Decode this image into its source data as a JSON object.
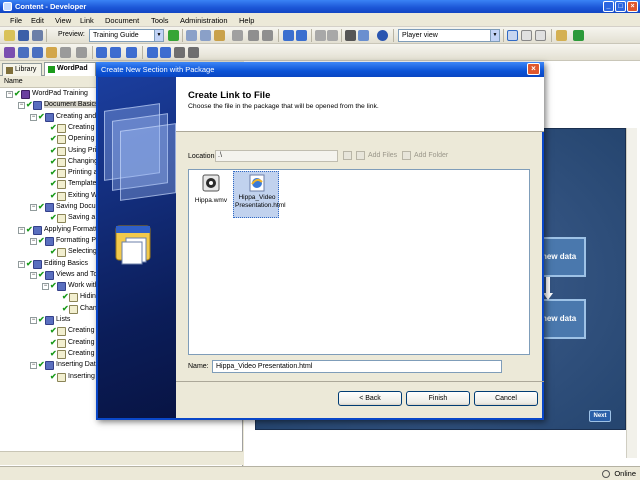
{
  "window": {
    "title": "Content - Developer"
  },
  "menu": [
    "File",
    "Edit",
    "View",
    "Link",
    "Document",
    "Tools",
    "Administration",
    "Help"
  ],
  "toolbar": {
    "preview_label": "Preview:",
    "preview_value": "Training Guide",
    "view_value": "Player view"
  },
  "left_panel": {
    "tabs": [
      "Library",
      "WordPad"
    ],
    "column_header": "Name",
    "tree": [
      {
        "label": "WordPad Training",
        "level": 0,
        "kind": "root"
      },
      {
        "label": "Document Basics",
        "level": 1,
        "kind": "book",
        "selected": true
      },
      {
        "label": "Creating and",
        "level": 2,
        "kind": "book"
      },
      {
        "label": "Creating a",
        "level": 3,
        "kind": "page"
      },
      {
        "label": "Opening a",
        "level": 3,
        "kind": "page"
      },
      {
        "label": "Using Prin",
        "level": 3,
        "kind": "page"
      },
      {
        "label": "Changing",
        "level": 3,
        "kind": "page"
      },
      {
        "label": "Printing a",
        "level": 3,
        "kind": "page"
      },
      {
        "label": "Templates",
        "level": 3,
        "kind": "page"
      },
      {
        "label": "Exiting W",
        "level": 3,
        "kind": "page"
      },
      {
        "label": "Saving Docum",
        "level": 2,
        "kind": "book"
      },
      {
        "label": "Saving a",
        "level": 3,
        "kind": "page"
      },
      {
        "label": "Applying Formatti",
        "level": 1,
        "kind": "book"
      },
      {
        "label": "Formatting Pa",
        "level": 2,
        "kind": "book"
      },
      {
        "label": "Selecting",
        "level": 3,
        "kind": "page"
      },
      {
        "label": "Editing Basics",
        "level": 1,
        "kind": "book"
      },
      {
        "label": "Views and To",
        "level": 2,
        "kind": "book"
      },
      {
        "label": "Work with",
        "level": 3,
        "kind": "book"
      },
      {
        "label": "Hiding",
        "level": 4,
        "kind": "page"
      },
      {
        "label": "Chang",
        "level": 4,
        "kind": "page"
      },
      {
        "label": "Lists",
        "level": 2,
        "kind": "book"
      },
      {
        "label": "Creating",
        "level": 3,
        "kind": "page"
      },
      {
        "label": "Creating",
        "level": 3,
        "kind": "page"
      },
      {
        "label": "Creating",
        "level": 3,
        "kind": "page"
      },
      {
        "label": "Inserting Data",
        "level": 2,
        "kind": "book"
      },
      {
        "label": "Inserting",
        "level": 3,
        "kind": "page"
      }
    ]
  },
  "preview": {
    "box1": "new data",
    "box2": "new data",
    "next": "Next"
  },
  "status": {
    "text": "Online"
  },
  "dialog": {
    "title": "Create New Section with Package",
    "heading": "Create Link to File",
    "subtitle": "Choose the file in the package that will be opened from the link.",
    "location_label": "Location:",
    "location_value": ".\\",
    "add_files": "Add Files",
    "add_folder": "Add Folder",
    "files": [
      {
        "name": "Hippa.wmv",
        "icon": "media-file-icon",
        "selected": false
      },
      {
        "name": "Hippa_Video Presentation.html",
        "icon": "html-file-icon",
        "selected": true
      }
    ],
    "name_label": "Name:",
    "name_value": "Hippa_Video Presentation.html",
    "buttons": {
      "back": "< Back",
      "finish": "Finish",
      "cancel": "Cancel"
    }
  }
}
